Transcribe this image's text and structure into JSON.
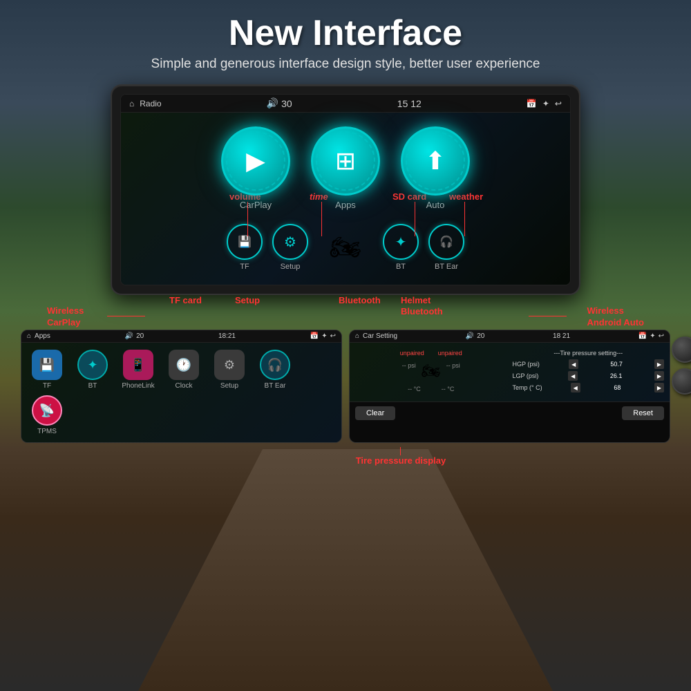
{
  "header": {
    "title": "New Interface",
    "subtitle": "Simple and generous interface design style, better user experience"
  },
  "annotations": {
    "volume": "volume",
    "time": "time",
    "sd_card": "SD card",
    "weather": "weather",
    "wireless_carplay": "Wireless\nCarPlay",
    "wireless_android": "Wireless\nAndroid Auto",
    "tf_card": "TF card",
    "setup": "Setup",
    "bluetooth": "Bluetooth",
    "helmet_bluetooth": "Helmet\nBluetooth",
    "tire_pressure": "Tire pressure\ndisplay"
  },
  "main_screen": {
    "status_bar": {
      "home_icon": "⌂",
      "label": "Radio",
      "volume_icon": "🔊",
      "volume_value": "30",
      "time": "15  12",
      "sd_icon": "📅",
      "brightness_icon": "✦",
      "back_icon": "↩"
    },
    "main_icons": [
      {
        "label": "CarPlay",
        "icon": "▶"
      },
      {
        "label": "Apps",
        "icon": "⊞"
      },
      {
        "label": "Auto",
        "icon": "⬆"
      }
    ],
    "small_icons": [
      {
        "label": "TF",
        "icon": "📱",
        "type": "teal"
      },
      {
        "label": "Setup",
        "icon": "⚙",
        "type": "teal"
      },
      {
        "label": "motorcycle",
        "icon": "🏍",
        "type": "moto"
      },
      {
        "label": "BT",
        "icon": "✦",
        "type": "teal"
      },
      {
        "label": "BT Ear",
        "icon": "🎧",
        "type": "teal"
      }
    ]
  },
  "left_panel": {
    "status_bar": {
      "home_icon": "⌂",
      "label": "Apps",
      "volume_icon": "🔊",
      "volume_value": "20",
      "time": "18:21",
      "sd_icon": "📅",
      "brightness_icon": "✦",
      "back_icon": "↩"
    },
    "apps": [
      {
        "label": "TF",
        "type": "blue"
      },
      {
        "label": "BT",
        "type": "cyan"
      },
      {
        "label": "PhoneLink",
        "type": "pink"
      },
      {
        "label": "Clock",
        "type": "gray"
      },
      {
        "label": "Setup",
        "type": "gray"
      },
      {
        "label": "BT Ear",
        "type": "teal"
      },
      {
        "label": "TPMS",
        "type": "pink2"
      }
    ]
  },
  "right_panel": {
    "status_bar": {
      "home_icon": "⌂",
      "label": "Car Setting",
      "volume_icon": "🔊",
      "volume_value": "20",
      "time": "18  21",
      "sd_icon": "📅",
      "brightness_icon": "✦",
      "back_icon": "↩"
    },
    "tire_sensors": {
      "left_status": "unpaired",
      "right_status": "unpaired",
      "left_psi": "-- psi",
      "right_psi": "-- psi",
      "left_temp": "-- °C",
      "right_temp": "-- °C"
    },
    "tire_settings": {
      "title": "---Tire pressure setting---",
      "rows": [
        {
          "label": "HGP (psi)",
          "value": "50.7"
        },
        {
          "label": "LGP (psi)",
          "value": "26.1"
        },
        {
          "label": "Temp (° C)",
          "value": "68"
        }
      ]
    },
    "buttons": {
      "clear": "Clear",
      "reset": "Reset"
    }
  },
  "bottom_annotation": "Tire pressure\ndisplay"
}
